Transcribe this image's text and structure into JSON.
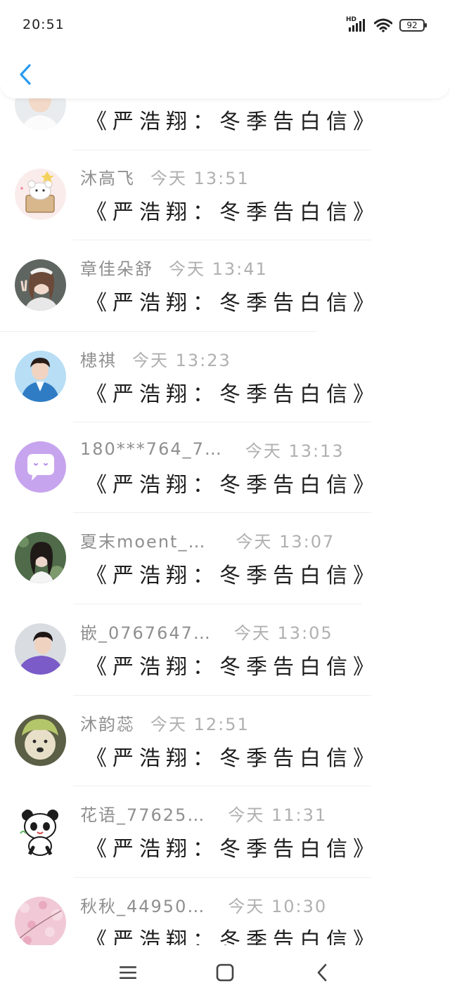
{
  "status_bar": {
    "time": "20:51",
    "network": "HD",
    "battery": "92"
  },
  "header": {
    "back_icon": "chevron-left-icon",
    "accent_color": "#2a9bf0"
  },
  "messages": [
    {
      "name": "",
      "time": "",
      "text": "《严浩翔：冬季告白信》",
      "avatar": "avatar-boy-white-shirt"
    },
    {
      "name": "沐高飞",
      "time": "今天 13:51",
      "text": "《严浩翔：冬季告白信》",
      "avatar": "avatar-cartoon-bear-box"
    },
    {
      "name": "章佳朵舒",
      "time": "今天 13:41",
      "text": "《严浩翔：冬季告白信》",
      "avatar": "avatar-girl-peace-sign"
    },
    {
      "name": "槵祺",
      "time": "今天 13:23",
      "text": "《严浩翔：冬季告白信》",
      "avatar": "avatar-boy-blue-jacket"
    },
    {
      "name": "180***764_7…",
      "time": "今天 13:13",
      "text": "《严浩翔：冬季告白信》",
      "avatar": "avatar-purple-chat-bubble"
    },
    {
      "name": "夏末moent_…",
      "time": "今天 13:07",
      "text": "《严浩翔：冬季告白信》",
      "avatar": "avatar-girl-green-background"
    },
    {
      "name": "嵌_0767647…",
      "time": "今天 13:05",
      "text": "《严浩翔：冬季告白信》",
      "avatar": "avatar-boy-purple-shirt"
    },
    {
      "name": "沐韵蕊",
      "time": "今天 12:51",
      "text": "《严浩翔：冬季告白信》",
      "avatar": "avatar-dog-green-hat"
    },
    {
      "name": "花语_77625…",
      "time": "今天 11:31",
      "text": "《严浩翔：冬季告白信》",
      "avatar": "avatar-cartoon-panda"
    },
    {
      "name": "秋秋_44950…",
      "time": "今天 10:30",
      "text": "《严浩翔：冬季告白信》",
      "avatar": "avatar-pink-blossoms"
    }
  ],
  "nav_bar": {
    "menu_icon": "menu-icon",
    "home_icon": "home-square-icon",
    "back_icon": "back-triangle-icon"
  }
}
